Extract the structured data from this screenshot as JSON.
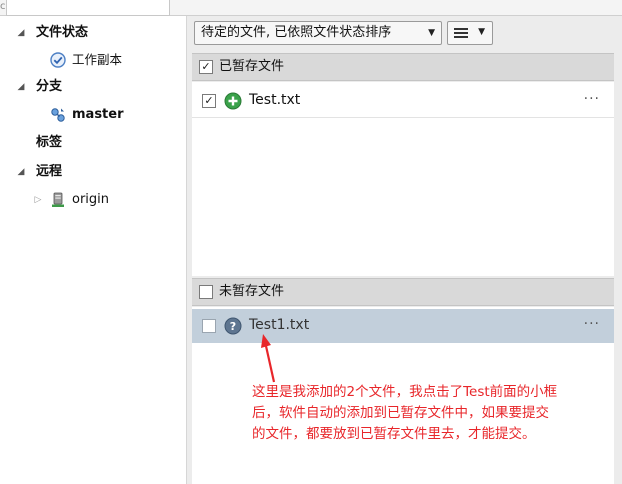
{
  "sidebar": {
    "file_status": {
      "label": "文件状态",
      "children": [
        {
          "label": "工作副本"
        }
      ]
    },
    "branches": {
      "label": "分支",
      "children": [
        {
          "label": "master"
        }
      ]
    },
    "tags": {
      "label": "标签"
    },
    "remotes": {
      "label": "远程",
      "children": [
        {
          "label": "origin"
        }
      ]
    }
  },
  "toolbar": {
    "filter_selected": "待定的文件, 已依照文件状态排序"
  },
  "staged": {
    "header": "已暂存文件",
    "files": [
      {
        "name": "Test.txt",
        "more": "···",
        "checked": true,
        "status_icon": "added-plus-icon"
      }
    ]
  },
  "unstaged": {
    "header": "未暂存文件",
    "files": [
      {
        "name": "Test1.txt",
        "more": "···",
        "checked": false,
        "status_icon": "untracked-question-icon"
      }
    ]
  },
  "annotation": {
    "lines": [
      "这里是我添加的2个文件，我点击了Test前面的小框",
      "后，软件自动的添加到已暂存文件中，如果要提交",
      "的文件，都要放到已暂存文件里去，才能提交。"
    ]
  },
  "colors": {
    "selected_row": "#c2cfdb",
    "annotation": "#e8262a",
    "added_icon": "#3aa24a",
    "question_icon": "#5e7590"
  }
}
